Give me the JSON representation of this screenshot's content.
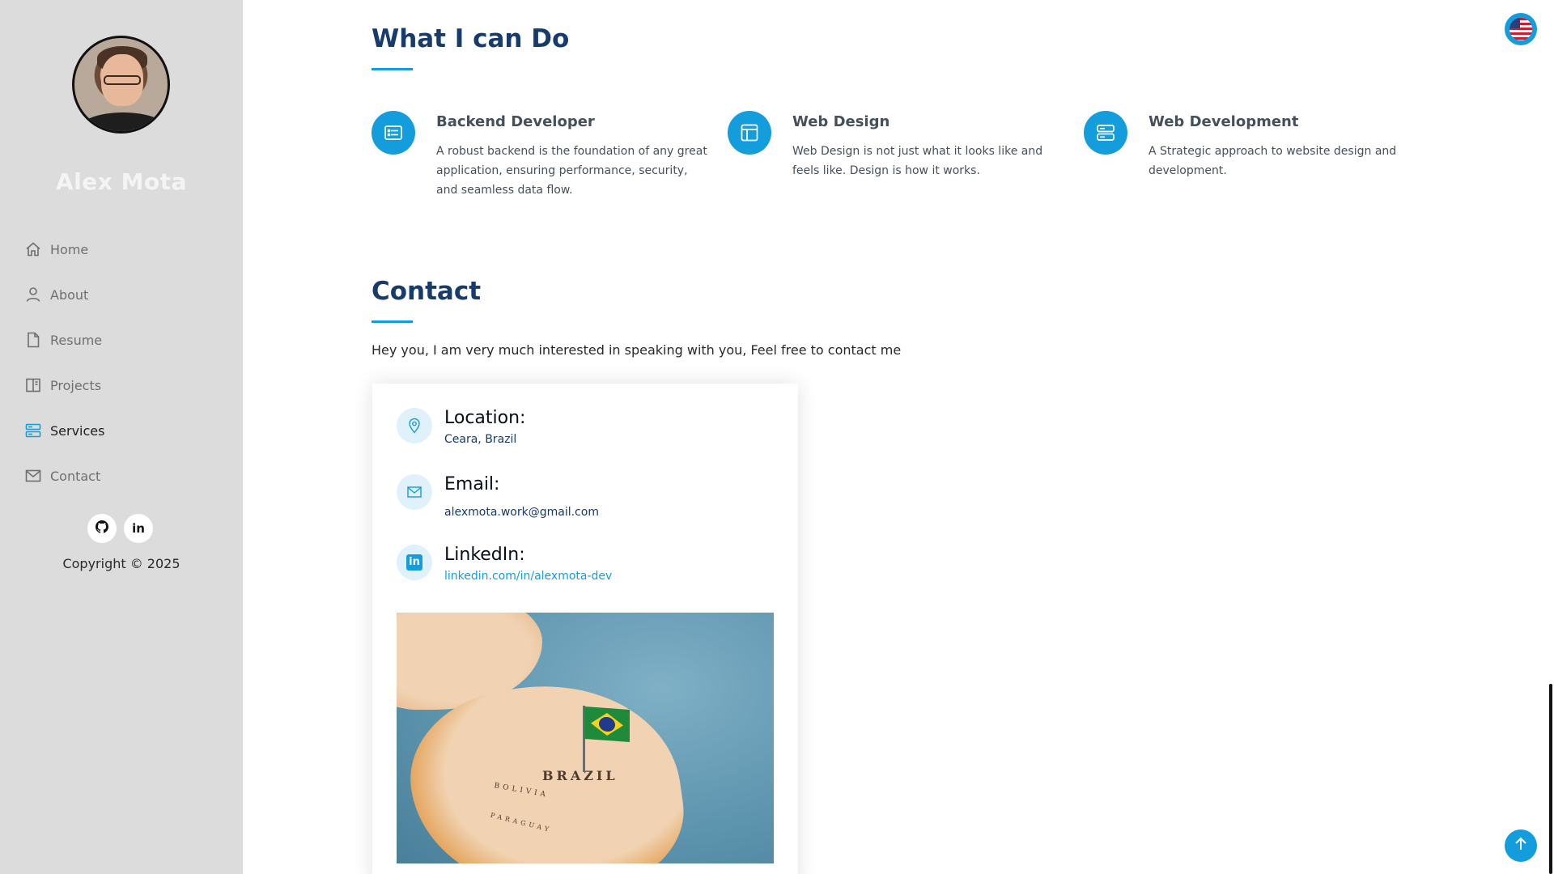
{
  "sidebar": {
    "name": "Alex Mota",
    "nav": [
      {
        "label": "Home",
        "icon": "home-icon",
        "active": false
      },
      {
        "label": "About",
        "icon": "person-icon",
        "active": false
      },
      {
        "label": "Resume",
        "icon": "file-icon",
        "active": false
      },
      {
        "label": "Projects",
        "icon": "book-icon",
        "active": false
      },
      {
        "label": "Services",
        "icon": "server-icon",
        "active": true
      },
      {
        "label": "Contact",
        "icon": "envelope-icon",
        "active": false
      }
    ],
    "social": [
      {
        "name": "github",
        "icon": "github-icon"
      },
      {
        "name": "linkedin",
        "icon": "linkedin-icon",
        "glyph": "in"
      }
    ],
    "copyright": "Copyright © 2025"
  },
  "services": {
    "title": "What I can Do",
    "items": [
      {
        "title": "Backend Developer",
        "description": "A robust backend is the foundation of any great application, ensuring performance, security, and seamless data flow.",
        "icon": "card-list-icon"
      },
      {
        "title": "Web Design",
        "description": "Web Design is not just what it looks like and feels like. Design is how it works.",
        "icon": "layout-icon"
      },
      {
        "title": "Web Development",
        "description": "A Strategic approach to website design and development.",
        "icon": "server-icon"
      }
    ]
  },
  "contact": {
    "title": "Contact",
    "intro": "Hey you, I am very much interested in speaking with you, Feel free to contact me",
    "location": {
      "label": "Location:",
      "value": "Ceara, Brazil"
    },
    "email": {
      "label": "Email:",
      "value": "alexmota.work@gmail.com"
    },
    "linkedin": {
      "label": "LinkedIn:",
      "value": "linkedin.com/in/alexmota-dev",
      "glyph": "in"
    },
    "map": {
      "labels": [
        "BRAZIL",
        "BOLIVIA",
        "PARAGUAY"
      ]
    }
  },
  "colors": {
    "accent": "#149ddd",
    "heading": "#173b6c",
    "sidebar_bg": "#dcdcdc"
  }
}
